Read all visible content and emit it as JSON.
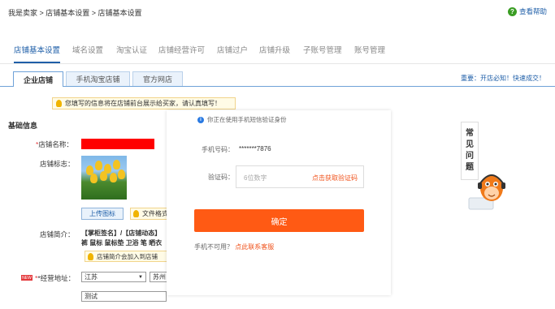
{
  "breadcrumb": "我是卖家 > 店铺基本设置 > 店铺基本设置",
  "help": {
    "label": "查看帮助",
    "icon": "question-circle-icon",
    "color": "#3a9d23"
  },
  "nav_tabs": [
    {
      "label": "店铺基本设置",
      "active": true
    },
    {
      "label": "域名设置",
      "active": false
    },
    {
      "label": "淘宝认证",
      "active": false
    },
    {
      "label": "店铺经营许可",
      "active": false
    },
    {
      "label": "店铺过户",
      "active": false
    },
    {
      "label": "店铺升级",
      "active": false
    },
    {
      "label": "子账号管理",
      "active": false
    },
    {
      "label": "账号管理",
      "active": false
    }
  ],
  "sub_tabs": [
    {
      "label": "企业店铺",
      "active": true
    },
    {
      "label": "手机淘宝店铺",
      "active": false
    },
    {
      "label": "官方网店",
      "active": false
    }
  ],
  "notice_right": "重要：开店必知！快速成交！",
  "tip": "您填写的信息将在店铺前台展示给买家，请认真填写！",
  "form": {
    "section_title": "基础信息",
    "shop_name_label": "店铺名称：",
    "shop_name_required": "*",
    "shop_logo_label": "店铺标志：",
    "upload_button": "上传图标",
    "file_hint": "文件格式",
    "intro_label": "店铺简介：",
    "intro_text": "【掌柜签名】/【店铺动态】裤 鼠标 鼠标垫 卫浴 笔 晒衣",
    "intro_tip": "店铺简介会加入到店铺",
    "address_new_badge": "NEW",
    "address_label": "*经营地址：",
    "province": "江苏",
    "city": "苏州",
    "detail_address": "测试"
  },
  "modal": {
    "info": "你正在使用手机短信验证身份",
    "phone_label": "手机号码：",
    "phone_value": "*******7876",
    "code_label": "验证码：",
    "code_placeholder": "6位数字",
    "get_code": "点击获取验证码",
    "confirm": "确定",
    "bottom_text": "手机不可用？",
    "bottom_link": "点此联系客服",
    "accent_color": "#ff5a14"
  },
  "faq": [
    "常",
    "见",
    "问",
    "题"
  ]
}
